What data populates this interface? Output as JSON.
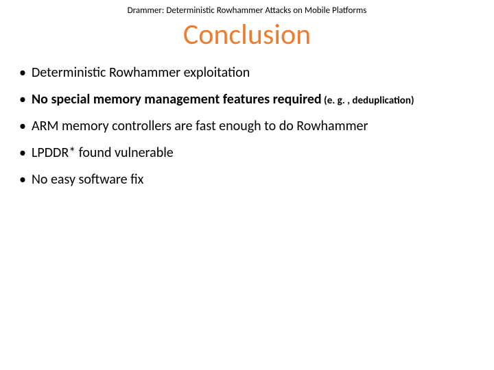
{
  "header": "Drammer: Deterministic Rowhammer Attacks on Mobile Platforms",
  "title": "Conclusion",
  "bullets": {
    "b1": "Deterministic Rowhammer exploitation",
    "b2_main": "No special memory management features required",
    "b2_trail": " (e. g. , deduplication)",
    "b3": "ARM memory controllers are fast enough to do Rowhammer",
    "b4": "LPDDR* found vulnerable",
    "b5": "No easy software fix"
  }
}
